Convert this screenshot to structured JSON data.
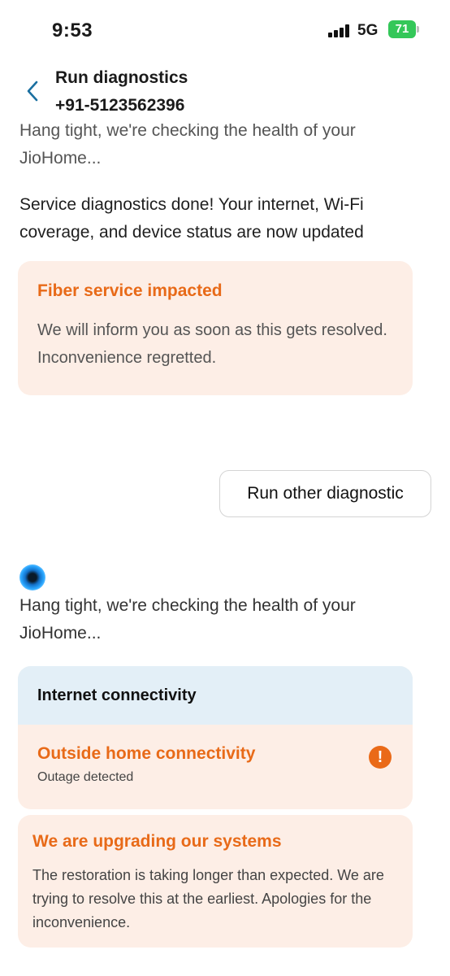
{
  "status_bar": {
    "time": "9:53",
    "network": "5G",
    "battery": "71",
    "battery_color": "#34c759"
  },
  "header": {
    "title": "Run diagnostics",
    "phone": "+91-5123562396",
    "back_icon": "chevron-left-icon"
  },
  "chat": {
    "partial_message": "Hang tight, we're checking the health of your JioHome...",
    "done_message": "Service diagnostics done! Your internet, Wi-Fi coverage, and device status are now updated",
    "fiber_alert": {
      "title": "Fiber service impacted",
      "body": "We will inform you as soon as this gets resolved. Inconvenience regretted."
    },
    "option_chip": "Run other diagnostic",
    "checking_message": "Hang tight, we're checking the health of your JioHome...",
    "connectivity_card": {
      "header": "Internet connectivity",
      "row_title": "Outside home connectivity",
      "row_status": "Outage detected",
      "status_icon": "exclamation-icon"
    },
    "upgrade_alert": {
      "title": "We are upgrading our systems",
      "body": "The restoration is taking longer than expected. We are trying to resolve this at the earliest. Apologies for the inconvenience."
    }
  },
  "colors": {
    "accent_orange": "#e86a18",
    "alert_background": "#fdeee6",
    "card_header_background": "#e3eff7",
    "back_icon": "#1a6fa0"
  }
}
